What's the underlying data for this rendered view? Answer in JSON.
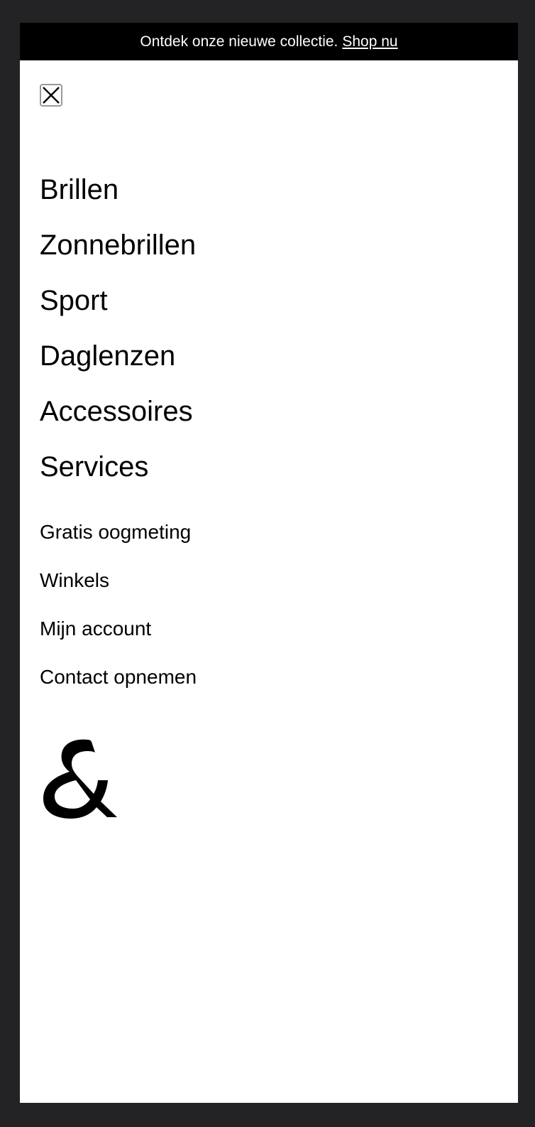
{
  "promo": {
    "text": "Ontdek onze nieuwe collectie.",
    "link_label": "Shop nu"
  },
  "close_button": {
    "icon": "close-icon",
    "aria_label": "Sluiten"
  },
  "primary_nav": [
    {
      "label": "Brillen"
    },
    {
      "label": "Zonnebrillen"
    },
    {
      "label": "Sport"
    },
    {
      "label": "Daglenzen"
    },
    {
      "label": "Accessoires"
    },
    {
      "label": "Services"
    }
  ],
  "secondary_nav": [
    {
      "label": "Gratis oogmeting"
    },
    {
      "label": "Winkels"
    },
    {
      "label": "Mijn account"
    },
    {
      "label": "Contact opnemen"
    }
  ],
  "brand": {
    "logo": "ampersand-logo",
    "logo_text": "&"
  },
  "colors": {
    "promo_background": "#000000",
    "promo_text": "#ffffff",
    "panel_background": "#ffffff",
    "page_background": "#232325",
    "text": "#000000"
  }
}
